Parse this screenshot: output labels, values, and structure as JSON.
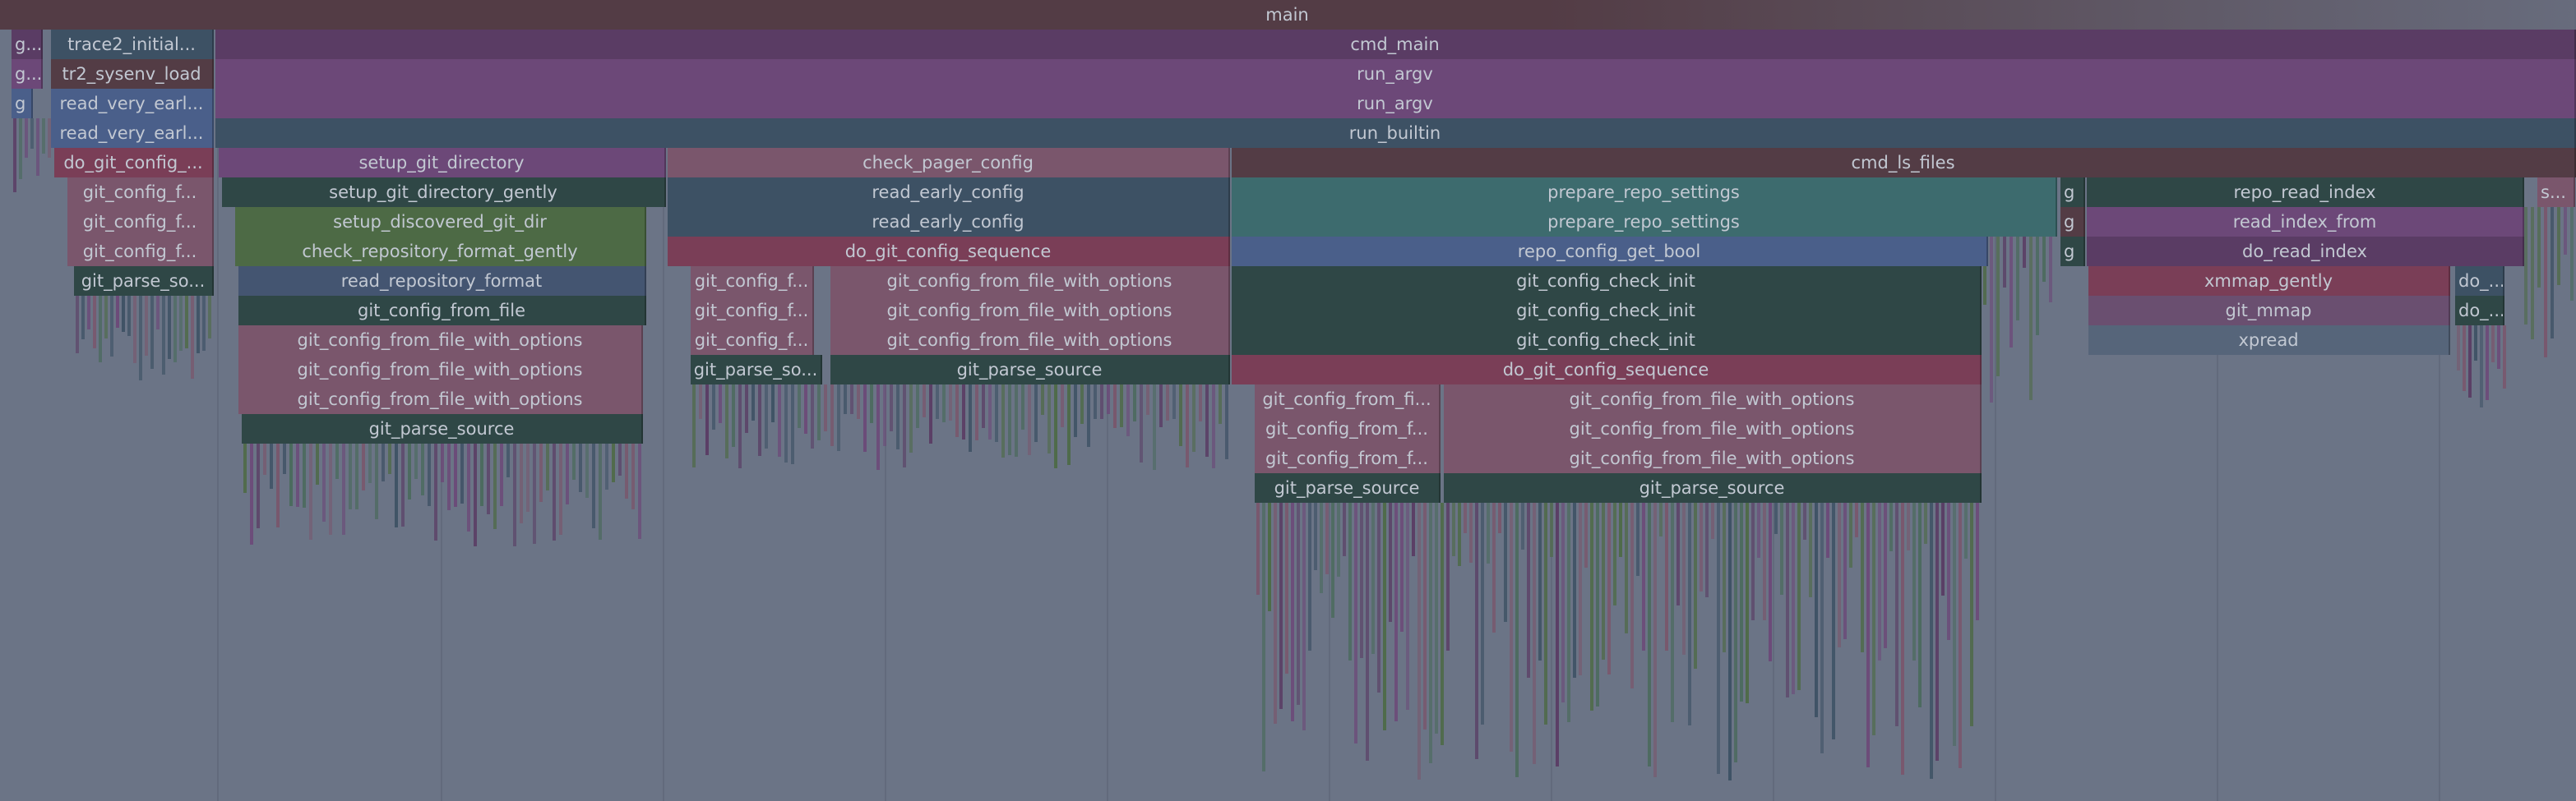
{
  "flamegraph": {
    "colors": {
      "background": "#6b7486",
      "brown": "#533c45",
      "purple": "#5a3c64",
      "magenta": "#6c4878",
      "slate": "#3d5164",
      "teal": "#3d6b6e",
      "dark_green": "#2f4746",
      "olive": "#4d6a45",
      "rose": "#7a566c",
      "red": "#7a3e57",
      "blue": "#4a5f8a",
      "steel": "#445571",
      "plum": "#6a4f70",
      "gray_blue": "#56657a"
    },
    "frames": [
      {
        "name": "main",
        "text": "main",
        "color": "brown"
      },
      {
        "name": "cmd-main",
        "text": "cmd_main",
        "color": "purple"
      },
      {
        "name": "run-argv-1",
        "text": "run_argv",
        "color": "magenta"
      },
      {
        "name": "run-argv-2",
        "text": "run_argv",
        "color": "magenta"
      },
      {
        "name": "run-builtin",
        "text": "run_builtin",
        "color": "slate"
      },
      {
        "name": "trace2-initial",
        "text": "trace2_initial...",
        "color": "slate"
      },
      {
        "name": "tr2-sysenv-load",
        "text": "tr2_sysenv_load",
        "color": "brown"
      },
      {
        "name": "read-very-early-1",
        "text": "read_very_earl...",
        "color": "blue"
      },
      {
        "name": "read-very-early-2",
        "text": "read_very_earl...",
        "color": "blue"
      },
      {
        "name": "do-git-config-left",
        "text": "do_git_config_...",
        "color": "red"
      },
      {
        "name": "git-config-f-left-1",
        "text": "git_config_f...",
        "color": "rose"
      },
      {
        "name": "git-config-f-left-2",
        "text": "git_config_f...",
        "color": "rose"
      },
      {
        "name": "git-config-f-left-3",
        "text": "git_config_f...",
        "color": "rose"
      },
      {
        "name": "git-parse-so-left",
        "text": "git_parse_so...",
        "color": "dark_green"
      },
      {
        "name": "g-left-1",
        "text": "g...",
        "color": "purple"
      },
      {
        "name": "g-left-2",
        "text": "g...",
        "color": "magenta"
      },
      {
        "name": "g-left-3",
        "text": "g",
        "color": "blue"
      },
      {
        "name": "setup-git-directory",
        "text": "setup_git_directory",
        "color": "magenta"
      },
      {
        "name": "setup-git-directory-gently",
        "text": "setup_git_directory_gently",
        "color": "dark_green"
      },
      {
        "name": "setup-discovered-git-dir",
        "text": "setup_discovered_git_dir",
        "color": "olive"
      },
      {
        "name": "check-repository-format-gently",
        "text": "check_repository_format_gently",
        "color": "olive"
      },
      {
        "name": "read-repository-format",
        "text": "read_repository_format",
        "color": "steel"
      },
      {
        "name": "git-config-from-file",
        "text": "git_config_from_file",
        "color": "dark_green"
      },
      {
        "name": "gcffwo-setup-1",
        "text": "git_config_from_file_with_options",
        "color": "rose"
      },
      {
        "name": "gcffwo-setup-2",
        "text": "git_config_from_file_with_options",
        "color": "rose"
      },
      {
        "name": "gcffwo-setup-3",
        "text": "git_config_from_file_with_options",
        "color": "rose"
      },
      {
        "name": "git-parse-source-setup",
        "text": "git_parse_source",
        "color": "dark_green"
      },
      {
        "name": "check-pager-config",
        "text": "check_pager_config",
        "color": "rose"
      },
      {
        "name": "read-early-config-1",
        "text": "read_early_config",
        "color": "slate"
      },
      {
        "name": "read-early-config-2",
        "text": "read_early_config",
        "color": "slate"
      },
      {
        "name": "do-git-config-sequence-mid",
        "text": "do_git_config_sequence",
        "color": "red"
      },
      {
        "name": "git-config-f-mid-1",
        "text": "git_config_f...",
        "color": "rose"
      },
      {
        "name": "git-config-f-mid-2",
        "text": "git_config_f...",
        "color": "rose"
      },
      {
        "name": "git-config-f-mid-3",
        "text": "git_config_f...",
        "color": "rose"
      },
      {
        "name": "git-parse-so-mid",
        "text": "git_parse_so...",
        "color": "dark_green"
      },
      {
        "name": "gcffwo-mid-1",
        "text": "git_config_from_file_with_options",
        "color": "rose"
      },
      {
        "name": "gcffwo-mid-2",
        "text": "git_config_from_file_with_options",
        "color": "rose"
      },
      {
        "name": "gcffwo-mid-3",
        "text": "git_config_from_file_with_options",
        "color": "rose"
      },
      {
        "name": "git-parse-source-mid",
        "text": "git_parse_source",
        "color": "dark_green"
      },
      {
        "name": "cmd-ls-files",
        "text": "cmd_ls_files",
        "color": "brown"
      },
      {
        "name": "prepare-repo-settings-1",
        "text": "prepare_repo_settings",
        "color": "teal"
      },
      {
        "name": "prepare-repo-settings-2",
        "text": "prepare_repo_settings",
        "color": "teal"
      },
      {
        "name": "repo-config-get-bool",
        "text": "repo_config_get_bool",
        "color": "blue"
      },
      {
        "name": "git-config-check-init-1",
        "text": "git_config_check_init",
        "color": "dark_green"
      },
      {
        "name": "git-config-check-init-2",
        "text": "git_config_check_init",
        "color": "dark_green"
      },
      {
        "name": "git-config-check-init-3",
        "text": "git_config_check_init",
        "color": "dark_green"
      },
      {
        "name": "do-git-config-sequence-right",
        "text": "do_git_config_sequence",
        "color": "red"
      },
      {
        "name": "git-config-from-fi",
        "text": "git_config_from_fi...",
        "color": "rose"
      },
      {
        "name": "git-config-from-f-1",
        "text": "git_config_from_f...",
        "color": "rose"
      },
      {
        "name": "git-config-from-f-2",
        "text": "git_config_from_f...",
        "color": "rose"
      },
      {
        "name": "git-parse-source-right-1",
        "text": "git_parse_source",
        "color": "dark_green"
      },
      {
        "name": "gcffwo-right-1",
        "text": "git_config_from_file_with_options",
        "color": "rose"
      },
      {
        "name": "gcffwo-right-2",
        "text": "git_config_from_file_with_options",
        "color": "rose"
      },
      {
        "name": "gcffwo-right-3",
        "text": "git_config_from_file_with_options",
        "color": "rose"
      },
      {
        "name": "git-parse-source-right-2",
        "text": "git_parse_source",
        "color": "dark_green"
      },
      {
        "name": "g-right-1",
        "text": "g",
        "color": "dark_green"
      },
      {
        "name": "g-right-2",
        "text": "g",
        "color": "brown"
      },
      {
        "name": "g-right-3",
        "text": "g",
        "color": "dark_green"
      },
      {
        "name": "repo-read-index",
        "text": "repo_read_index",
        "color": "dark_green"
      },
      {
        "name": "read-index-from",
        "text": "read_index_from",
        "color": "magenta"
      },
      {
        "name": "do-read-index",
        "text": "do_read_index",
        "color": "purple"
      },
      {
        "name": "xmmap-gently",
        "text": "xmmap_gently",
        "color": "red"
      },
      {
        "name": "git-mmap",
        "text": "git_mmap",
        "color": "plum"
      },
      {
        "name": "xpread",
        "text": "xpread",
        "color": "gray_blue"
      },
      {
        "name": "do-right-1",
        "text": "do_...",
        "color": "slate"
      },
      {
        "name": "do-right-2",
        "text": "do_...",
        "color": "dark_green"
      },
      {
        "name": "s-right",
        "text": "s...",
        "color": "rose"
      }
    ]
  }
}
